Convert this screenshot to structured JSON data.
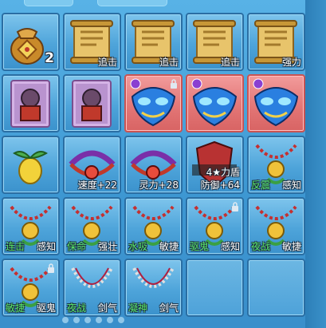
{
  "inventory": {
    "rows": [
      [
        {
          "item": "lucky-bag",
          "count": "2"
        },
        {
          "item": "scroll",
          "label": "追击"
        },
        {
          "item": "scroll",
          "label": "追击"
        },
        {
          "item": "scroll",
          "label": "追击"
        },
        {
          "item": "scroll",
          "label": "强力"
        }
      ],
      [
        {
          "item": "monster-card"
        },
        {
          "item": "monster-card"
        },
        {
          "item": "blue-mask",
          "highlight": "red",
          "locked": true
        },
        {
          "item": "blue-mask",
          "highlight": "red"
        },
        {
          "item": "blue-mask",
          "highlight": "red"
        }
      ],
      [
        {
          "item": "golden-fruit"
        },
        {
          "item": "demon-necklace",
          "label": "速度+22"
        },
        {
          "item": "demon-necklace",
          "label": "灵力+28"
        },
        {
          "item": "shield-badge",
          "badge": "4★力盾",
          "label": "防御+64"
        },
        {
          "item": "amulet",
          "label_green": "反震",
          "label": "感知"
        }
      ],
      [
        {
          "item": "amulet",
          "label_green": "连击",
          "label": "感知"
        },
        {
          "item": "amulet",
          "label_green": "保命",
          "label": "强壮"
        },
        {
          "item": "amulet",
          "label_green": "水吸",
          "label": "敏捷"
        },
        {
          "item": "amulet",
          "label_green": "驱鬼",
          "label": "感知",
          "locked": true
        },
        {
          "item": "amulet",
          "label_green": "夜战",
          "label": "敏捷"
        }
      ],
      [
        {
          "item": "amulet",
          "label_green": "敏捷",
          "label": "驱鬼",
          "locked": true
        },
        {
          "item": "chain",
          "label_green": "夜战",
          "label": "剑气"
        },
        {
          "item": "chain",
          "label_green": "凝神",
          "label": "剑气"
        },
        {
          "item": "empty"
        },
        {
          "item": "empty"
        }
      ]
    ]
  },
  "colors": {
    "panel": "#3f9bd6",
    "slot_red": "#e27474",
    "label_green": "#59e86a"
  },
  "icons": [
    "lucky-bag-icon",
    "scroll-icon",
    "monster-card-icon",
    "blue-mask-icon",
    "golden-fruit-icon",
    "demon-necklace-icon",
    "shield-badge-icon",
    "amulet-icon",
    "chain-icon",
    "lock-icon"
  ]
}
